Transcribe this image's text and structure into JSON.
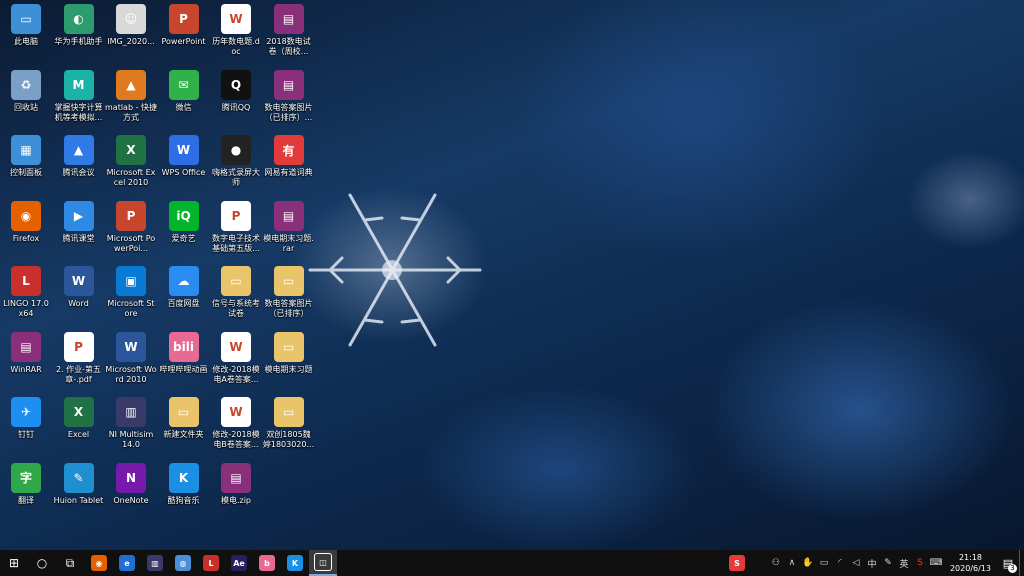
{
  "desktop": {
    "icons": [
      {
        "label": "此电脑",
        "color": "#3d8fd6",
        "glyph": "▭"
      },
      {
        "label": "华为手机助手",
        "color": "#2e9b6e",
        "glyph": "◐"
      },
      {
        "label": "IMG_2020...",
        "color": "#d9d9d9",
        "glyph": "☺"
      },
      {
        "label": "PowerPoint",
        "color": "#c8462d",
        "glyph": "P"
      },
      {
        "label": "历年数电题.doc",
        "color": "#ffffff",
        "glyph": "W"
      },
      {
        "label": "2018数电试卷（周校...",
        "color": "#8a2f7a",
        "glyph": "▤"
      },
      {
        "label": "回收站",
        "color": "#7aa0c8",
        "glyph": "♻"
      },
      {
        "label": "掌握快字计算机等考模拟...",
        "color": "#1ab3a6",
        "glyph": "M"
      },
      {
        "label": "matlab - 快捷方式",
        "color": "#e07a1e",
        "glyph": "▲"
      },
      {
        "label": "微信",
        "color": "#2fb24a",
        "glyph": "✉"
      },
      {
        "label": "腾讯QQ",
        "color": "#111111",
        "glyph": "Q"
      },
      {
        "label": "数电答案图片（已排序）...",
        "color": "#8a2f7a",
        "glyph": "▤"
      },
      {
        "label": "控制面板",
        "color": "#3d8fd6",
        "glyph": "▦"
      },
      {
        "label": "腾讯会议",
        "color": "#2f7ae5",
        "glyph": "▲"
      },
      {
        "label": "Microsoft Excel 2010",
        "color": "#207245",
        "glyph": "X"
      },
      {
        "label": "WPS Office",
        "color": "#2d6ee6",
        "glyph": "W"
      },
      {
        "label": "嗨格式录屏大师",
        "color": "#222222",
        "glyph": "●"
      },
      {
        "label": "网易有道词典",
        "color": "#e33a3a",
        "glyph": "有"
      },
      {
        "label": "Firefox",
        "color": "#e66000",
        "glyph": "◉"
      },
      {
        "label": "腾讯课堂",
        "color": "#2f8ae5",
        "glyph": "▶"
      },
      {
        "label": "Microsoft PowerPoi...",
        "color": "#c8462d",
        "glyph": "P"
      },
      {
        "label": "爱奇艺",
        "color": "#00b52c",
        "glyph": "iQ"
      },
      {
        "label": "数字电子技术基础第五版...",
        "color": "#ffffff",
        "glyph": "P"
      },
      {
        "label": "模电期末习题.rar",
        "color": "#8a2f7a",
        "glyph": "▤"
      },
      {
        "label": "LINGO 17.0 x64",
        "color": "#c9302c",
        "glyph": "L"
      },
      {
        "label": "Word",
        "color": "#2b579a",
        "glyph": "W"
      },
      {
        "label": "Microsoft Store",
        "color": "#0a7bd4",
        "glyph": "▣"
      },
      {
        "label": "百度网盘",
        "color": "#2a8cf0",
        "glyph": "☁"
      },
      {
        "label": "信号与系统考试卷",
        "color": "#e9c46a",
        "glyph": "▭"
      },
      {
        "label": "数电答案图片（已排序）",
        "color": "#e9c46a",
        "glyph": "▭"
      },
      {
        "label": "WinRAR",
        "color": "#8a2f7a",
        "glyph": "▤"
      },
      {
        "label": "2. 作业-第五章-.pdf",
        "color": "#ffffff",
        "glyph": "P"
      },
      {
        "label": "Microsoft Word 2010",
        "color": "#2b579a",
        "glyph": "W"
      },
      {
        "label": "哔哩哔哩动画",
        "color": "#e86a92",
        "glyph": "bili"
      },
      {
        "label": "修改-2018模电A卷答案...",
        "color": "#ffffff",
        "glyph": "W"
      },
      {
        "label": "模电期末习题",
        "color": "#e9c46a",
        "glyph": "▭"
      },
      {
        "label": "钉钉",
        "color": "#1d8ff0",
        "glyph": "✈"
      },
      {
        "label": "Excel",
        "color": "#207245",
        "glyph": "X"
      },
      {
        "label": "NI Multisim 14.0",
        "color": "#3a3a6a",
        "glyph": "▥"
      },
      {
        "label": "新建文件夹",
        "color": "#e9c46a",
        "glyph": "▭"
      },
      {
        "label": "修改-2018模电B卷答案...",
        "color": "#ffffff",
        "glyph": "W"
      },
      {
        "label": "双创1805魏婷1803020...",
        "color": "#e9c46a",
        "glyph": "▭"
      },
      {
        "label": "翻译",
        "color": "#2fa84a",
        "glyph": "字"
      },
      {
        "label": "Huion Tablet",
        "color": "#1f8fd0",
        "glyph": "✎"
      },
      {
        "label": "OneNote",
        "color": "#7719aa",
        "glyph": "N"
      },
      {
        "label": "酷狗音乐",
        "color": "#1a8fe3",
        "glyph": "K"
      },
      {
        "label": "模电.zip",
        "color": "#8a2f7a",
        "glyph": "▤"
      }
    ]
  },
  "taskbar": {
    "start_icon": "⊞",
    "search_icon": "○",
    "taskview_icon": "⧉",
    "pinned": [
      {
        "name": "firefox",
        "color": "#e66000",
        "glyph": "◉"
      },
      {
        "name": "edge",
        "color": "#1e6fd0",
        "glyph": "e"
      },
      {
        "name": "multisim",
        "color": "#3a3a6a",
        "glyph": "▥"
      },
      {
        "name": "globe",
        "color": "#4a90d9",
        "glyph": "◍"
      },
      {
        "name": "lingo",
        "color": "#c9302c",
        "glyph": "L"
      },
      {
        "name": "after-effects",
        "color": "#2a1f5e",
        "glyph": "Ae"
      },
      {
        "name": "bilibili",
        "color": "#e86a92",
        "glyph": "b"
      },
      {
        "name": "kugou",
        "color": "#1a8fe3",
        "glyph": "K"
      },
      {
        "name": "screen-recorder",
        "color": "#ffffff",
        "glyph": "◫"
      }
    ],
    "tray_left_app_glyph": "S",
    "clock_time": "21:18",
    "clock_date": "2020/6/13",
    "notification_count": "3"
  }
}
